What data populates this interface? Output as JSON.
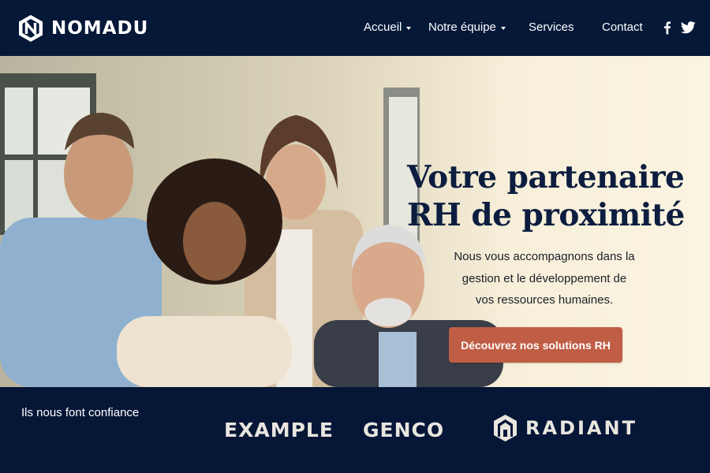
{
  "brand": {
    "name": "NOMADU",
    "logo_icon": "hexagon-n-logo-icon"
  },
  "nav": {
    "items": [
      {
        "label": "Accueil",
        "has_dropdown": true
      },
      {
        "label": "Notre équipe",
        "has_dropdown": true
      },
      {
        "label": "Services",
        "has_dropdown": false
      },
      {
        "label": "Contact",
        "has_dropdown": false
      }
    ],
    "social": [
      "facebook-icon",
      "twitter-icon"
    ]
  },
  "hero": {
    "title_lines": [
      "Votre partenaire",
      "RH de proximité"
    ],
    "subtitle_lines": [
      "Nous vous accompagnons dans la",
      "gestion et le développement de",
      "vos ressources humaines."
    ],
    "cta_label": "Découvrez nos solutions RH"
  },
  "trust": {
    "label": "Ils nous font confiance",
    "logos": [
      "EXAMPLE",
      "GENCO",
      "RADIANT"
    ]
  },
  "colors": {
    "header_bg": "#051838",
    "accent": "#c05d45",
    "title_text": "#0c1d3f",
    "hero_bg": "#fbf4e2"
  }
}
